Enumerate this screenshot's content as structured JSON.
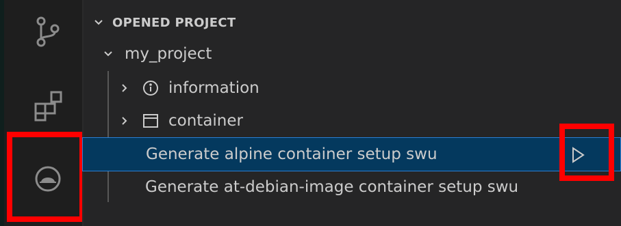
{
  "activity_bar": {
    "items": [
      {
        "name": "source-control-icon"
      },
      {
        "name": "extensions-icon"
      },
      {
        "name": "armadillo-icon",
        "active": true
      }
    ]
  },
  "explorer": {
    "section_title": "OPENED PROJECT",
    "project_name": "my_project",
    "items": [
      {
        "label": "information",
        "icon": "info-icon",
        "expandable": true
      },
      {
        "label": "container",
        "icon": "window-icon",
        "expandable": true
      },
      {
        "label": "Generate alpine container setup swu",
        "selected": true,
        "action": "run-icon"
      },
      {
        "label": "Generate at-debian-image container setup swu"
      }
    ]
  },
  "colors": {
    "highlight_box": "#ff0000",
    "selection_bg": "#04395e",
    "active_indicator": "#0078d4"
  }
}
